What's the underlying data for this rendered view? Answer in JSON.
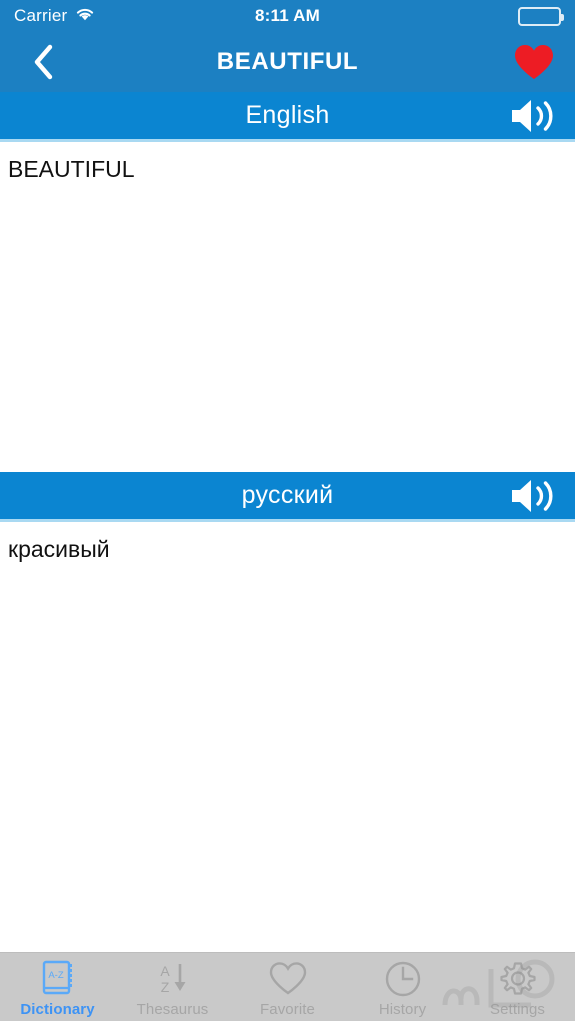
{
  "status_bar": {
    "carrier": "Carrier",
    "wifi_icon": "wifi-icon",
    "time": "8:11 AM",
    "battery_icon": "battery-full-icon"
  },
  "nav_bar": {
    "back_icon": "chevron-left-icon",
    "title": "BEAUTIFUL",
    "favorite_icon": "heart-filled-icon",
    "favorite_color": "#ed1c24",
    "background_color": "#1c80c2"
  },
  "panels": [
    {
      "language": "English",
      "speaker_icon": "speaker-icon",
      "word": "BEAUTIFUL",
      "header_color": "#0b85d1"
    },
    {
      "language": "русский",
      "speaker_icon": "speaker-icon",
      "word": "красивый",
      "header_color": "#0b85d1"
    }
  ],
  "tab_bar": {
    "background_color": "#c9c9c9",
    "active_color": "#3d93f5",
    "inactive_color": "#a6a6a6",
    "items": [
      {
        "label": "Dictionary",
        "icon": "dictionary-book-icon",
        "active": true
      },
      {
        "label": "Thesaurus",
        "icon": "sort-az-icon",
        "active": false
      },
      {
        "label": "Favorite",
        "icon": "heart-outline-icon",
        "active": false
      },
      {
        "label": "History",
        "icon": "clock-icon",
        "active": false
      },
      {
        "label": "Settings",
        "icon": "gear-icon",
        "active": false
      }
    ],
    "watermark_icon": "watermark-logo"
  }
}
